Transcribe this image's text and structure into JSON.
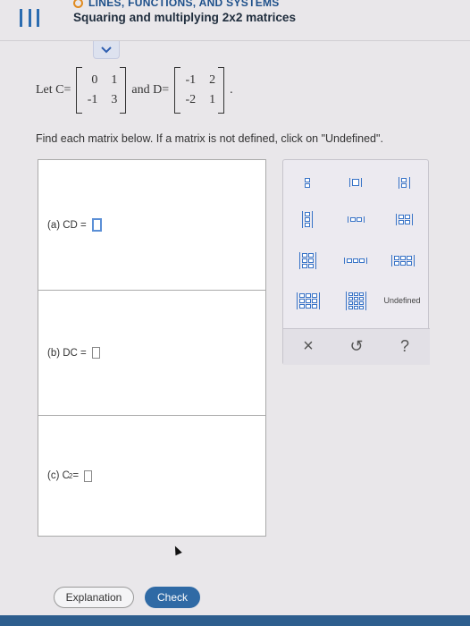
{
  "header": {
    "section": "LINES, FUNCTIONS, AND SYSTEMS",
    "title": "Squaring and multiplying 2x2 matrices"
  },
  "problem": {
    "let_c_label": "Let C=",
    "and_d_label": "and D=",
    "matrix_c": [
      "0",
      "1",
      "-1",
      "3"
    ],
    "matrix_d": [
      "-1",
      "2",
      "-2",
      "1"
    ],
    "period": ".",
    "instructions": "Find each matrix below. If a matrix is not defined, click on \"Undefined\"."
  },
  "answers": {
    "a_label": "(a)  CD  =",
    "b_label": "(b)  DC  =",
    "c_label": "(c)  C",
    "c_exp": "2",
    "c_eq": " ="
  },
  "palette": {
    "undefined_label": "Undefined",
    "clear_symbol": "×",
    "undo_symbol": "↺",
    "help_symbol": "?"
  },
  "footer": {
    "explanation_label": "Explanation",
    "check_label": "Check"
  },
  "colors": {
    "accent": "#3773c7",
    "check_button": "#2f6aa5",
    "section_dot": "#e08a1e"
  }
}
